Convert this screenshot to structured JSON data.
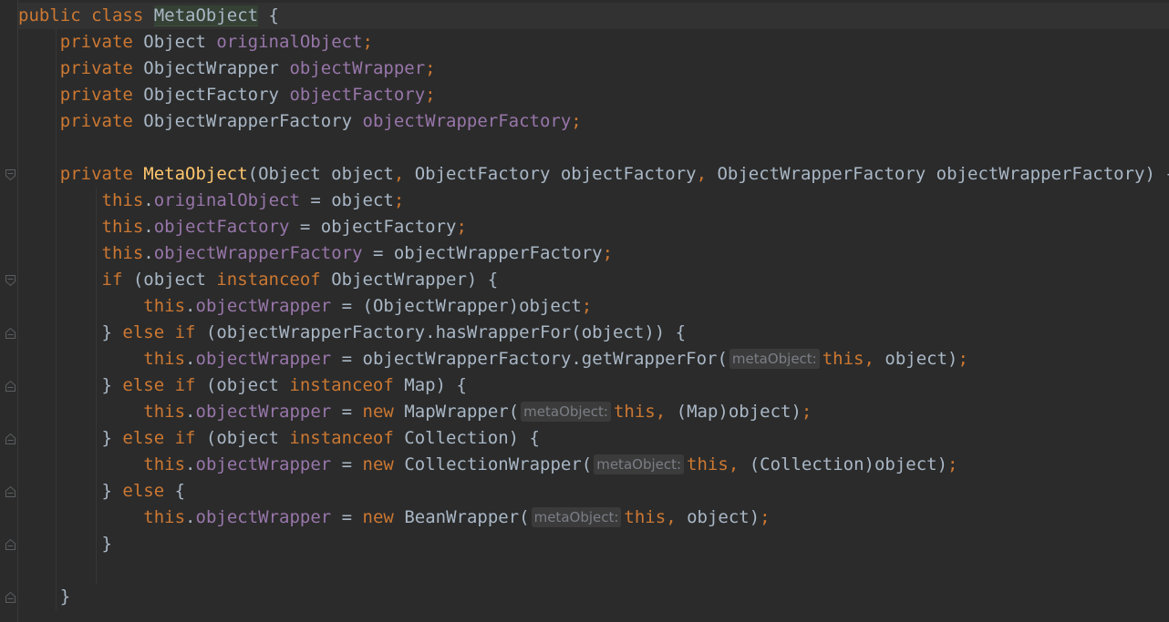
{
  "colors": {
    "background": "#2b2b2b",
    "text": "#a9b7c6",
    "keyword": "#cc7832",
    "field": "#9876aa",
    "method": "#ffc66d",
    "hint_bg": "#3b3b3b",
    "hint_text": "#7a7e85"
  },
  "editor": {
    "lines": [
      {
        "name": "class-declaration-line",
        "current": true,
        "tokens": [
          {
            "t": "public class ",
            "c": "kw"
          },
          {
            "t": "MetaObject",
            "c": "cls-hl"
          },
          {
            "t": " {",
            "c": ""
          }
        ]
      },
      {
        "name": "field-declaration-line",
        "tokens": [
          {
            "t": "    ",
            "c": ""
          },
          {
            "t": "private ",
            "c": "kw"
          },
          {
            "t": "Object ",
            "c": ""
          },
          {
            "t": "originalObject",
            "c": "fld"
          },
          {
            "t": ";",
            "c": "kw"
          }
        ]
      },
      {
        "name": "field-declaration-line",
        "tokens": [
          {
            "t": "    ",
            "c": ""
          },
          {
            "t": "private ",
            "c": "kw"
          },
          {
            "t": "ObjectWrapper ",
            "c": ""
          },
          {
            "t": "objectWrapper",
            "c": "fld"
          },
          {
            "t": ";",
            "c": "kw"
          }
        ]
      },
      {
        "name": "field-declaration-line",
        "tokens": [
          {
            "t": "    ",
            "c": ""
          },
          {
            "t": "private ",
            "c": "kw"
          },
          {
            "t": "ObjectFactory ",
            "c": ""
          },
          {
            "t": "objectFactory",
            "c": "fld"
          },
          {
            "t": ";",
            "c": "kw"
          }
        ]
      },
      {
        "name": "field-declaration-line",
        "tokens": [
          {
            "t": "    ",
            "c": ""
          },
          {
            "t": "private ",
            "c": "kw"
          },
          {
            "t": "ObjectWrapperFactory ",
            "c": ""
          },
          {
            "t": "objectWrapperFactory",
            "c": "fld"
          },
          {
            "t": ";",
            "c": "kw"
          }
        ]
      },
      {
        "name": "blank-line",
        "tokens": []
      },
      {
        "name": "constructor-declaration-line",
        "tokens": [
          {
            "t": "    ",
            "c": ""
          },
          {
            "t": "private ",
            "c": "kw"
          },
          {
            "t": "MetaObject",
            "c": "fn"
          },
          {
            "t": "(Object object",
            "c": ""
          },
          {
            "t": ", ",
            "c": "kw"
          },
          {
            "t": "ObjectFactory objectFactory",
            "c": ""
          },
          {
            "t": ", ",
            "c": "kw"
          },
          {
            "t": "ObjectWrapperFactory objectWrapperFactory) {",
            "c": ""
          }
        ]
      },
      {
        "name": "code-line",
        "tokens": [
          {
            "t": "        ",
            "c": ""
          },
          {
            "t": "this",
            "c": "kw"
          },
          {
            "t": ".",
            "c": ""
          },
          {
            "t": "originalObject",
            "c": "fld"
          },
          {
            "t": " = object",
            "c": ""
          },
          {
            "t": ";",
            "c": "kw"
          }
        ]
      },
      {
        "name": "code-line",
        "tokens": [
          {
            "t": "        ",
            "c": ""
          },
          {
            "t": "this",
            "c": "kw"
          },
          {
            "t": ".",
            "c": ""
          },
          {
            "t": "objectFactory",
            "c": "fld"
          },
          {
            "t": " = objectFactory",
            "c": ""
          },
          {
            "t": ";",
            "c": "kw"
          }
        ]
      },
      {
        "name": "code-line",
        "tokens": [
          {
            "t": "        ",
            "c": ""
          },
          {
            "t": "this",
            "c": "kw"
          },
          {
            "t": ".",
            "c": ""
          },
          {
            "t": "objectWrapperFactory",
            "c": "fld"
          },
          {
            "t": " = objectWrapperFactory",
            "c": ""
          },
          {
            "t": ";",
            "c": "kw"
          }
        ]
      },
      {
        "name": "code-line",
        "tokens": [
          {
            "t": "        ",
            "c": ""
          },
          {
            "t": "if ",
            "c": "kw"
          },
          {
            "t": "(object ",
            "c": ""
          },
          {
            "t": "instanceof ",
            "c": "kw"
          },
          {
            "t": "ObjectWrapper) {",
            "c": ""
          }
        ]
      },
      {
        "name": "code-line",
        "tokens": [
          {
            "t": "            ",
            "c": ""
          },
          {
            "t": "this",
            "c": "kw"
          },
          {
            "t": ".",
            "c": ""
          },
          {
            "t": "objectWrapper",
            "c": "fld"
          },
          {
            "t": " = (ObjectWrapper)object",
            "c": ""
          },
          {
            "t": ";",
            "c": "kw"
          }
        ]
      },
      {
        "name": "code-line",
        "tokens": [
          {
            "t": "        } ",
            "c": ""
          },
          {
            "t": "else if ",
            "c": "kw"
          },
          {
            "t": "(objectWrapperFactory.hasWrapperFor(object)) {",
            "c": ""
          }
        ]
      },
      {
        "name": "code-line",
        "tokens": [
          {
            "t": "            ",
            "c": ""
          },
          {
            "t": "this",
            "c": "kw"
          },
          {
            "t": ".",
            "c": ""
          },
          {
            "t": "objectWrapper",
            "c": "fld"
          },
          {
            "t": " = objectWrapperFactory.getWrapperFor(",
            "c": ""
          },
          {
            "t": "metaObject:",
            "c": "hint"
          },
          {
            "t": "this",
            "c": "kw"
          },
          {
            "t": ", ",
            "c": "kw"
          },
          {
            "t": "object)",
            "c": ""
          },
          {
            "t": ";",
            "c": "kw"
          }
        ]
      },
      {
        "name": "code-line",
        "tokens": [
          {
            "t": "        } ",
            "c": ""
          },
          {
            "t": "else if ",
            "c": "kw"
          },
          {
            "t": "(object ",
            "c": ""
          },
          {
            "t": "instanceof ",
            "c": "kw"
          },
          {
            "t": "Map) {",
            "c": ""
          }
        ]
      },
      {
        "name": "code-line",
        "tokens": [
          {
            "t": "            ",
            "c": ""
          },
          {
            "t": "this",
            "c": "kw"
          },
          {
            "t": ".",
            "c": ""
          },
          {
            "t": "objectWrapper",
            "c": "fld"
          },
          {
            "t": " = ",
            "c": ""
          },
          {
            "t": "new ",
            "c": "kw"
          },
          {
            "t": "MapWrapper(",
            "c": ""
          },
          {
            "t": "metaObject:",
            "c": "hint"
          },
          {
            "t": "this",
            "c": "kw"
          },
          {
            "t": ", ",
            "c": "kw"
          },
          {
            "t": "(Map)object)",
            "c": ""
          },
          {
            "t": ";",
            "c": "kw"
          }
        ]
      },
      {
        "name": "code-line",
        "tokens": [
          {
            "t": "        } ",
            "c": ""
          },
          {
            "t": "else if ",
            "c": "kw"
          },
          {
            "t": "(object ",
            "c": ""
          },
          {
            "t": "instanceof ",
            "c": "kw"
          },
          {
            "t": "Collection) {",
            "c": ""
          }
        ]
      },
      {
        "name": "code-line",
        "tokens": [
          {
            "t": "            ",
            "c": ""
          },
          {
            "t": "this",
            "c": "kw"
          },
          {
            "t": ".",
            "c": ""
          },
          {
            "t": "objectWrapper",
            "c": "fld"
          },
          {
            "t": " = ",
            "c": ""
          },
          {
            "t": "new ",
            "c": "kw"
          },
          {
            "t": "CollectionWrapper(",
            "c": ""
          },
          {
            "t": "metaObject:",
            "c": "hint"
          },
          {
            "t": "this",
            "c": "kw"
          },
          {
            "t": ", ",
            "c": "kw"
          },
          {
            "t": "(Collection)object)",
            "c": ""
          },
          {
            "t": ";",
            "c": "kw"
          }
        ]
      },
      {
        "name": "code-line",
        "tokens": [
          {
            "t": "        } ",
            "c": ""
          },
          {
            "t": "else ",
            "c": "kw"
          },
          {
            "t": "{",
            "c": ""
          }
        ]
      },
      {
        "name": "code-line",
        "tokens": [
          {
            "t": "            ",
            "c": ""
          },
          {
            "t": "this",
            "c": "kw"
          },
          {
            "t": ".",
            "c": ""
          },
          {
            "t": "objectWrapper",
            "c": "fld"
          },
          {
            "t": " = ",
            "c": ""
          },
          {
            "t": "new ",
            "c": "kw"
          },
          {
            "t": "BeanWrapper(",
            "c": ""
          },
          {
            "t": "metaObject:",
            "c": "hint"
          },
          {
            "t": "this",
            "c": "kw"
          },
          {
            "t": ", ",
            "c": "kw"
          },
          {
            "t": "object)",
            "c": ""
          },
          {
            "t": ";",
            "c": "kw"
          }
        ]
      },
      {
        "name": "code-line",
        "tokens": [
          {
            "t": "        }",
            "c": ""
          }
        ]
      },
      {
        "name": "blank-line",
        "tokens": []
      },
      {
        "name": "code-line",
        "tokens": [
          {
            "t": "    }",
            "c": ""
          }
        ]
      }
    ]
  },
  "gutter": {
    "fold_markers": [
      {
        "line": 6,
        "kind": "open"
      },
      {
        "line": 10,
        "kind": "open"
      },
      {
        "line": 12,
        "kind": "close"
      },
      {
        "line": 14,
        "kind": "close"
      },
      {
        "line": 16,
        "kind": "close"
      },
      {
        "line": 18,
        "kind": "close"
      },
      {
        "line": 20,
        "kind": "close"
      },
      {
        "line": 22,
        "kind": "close"
      }
    ]
  }
}
